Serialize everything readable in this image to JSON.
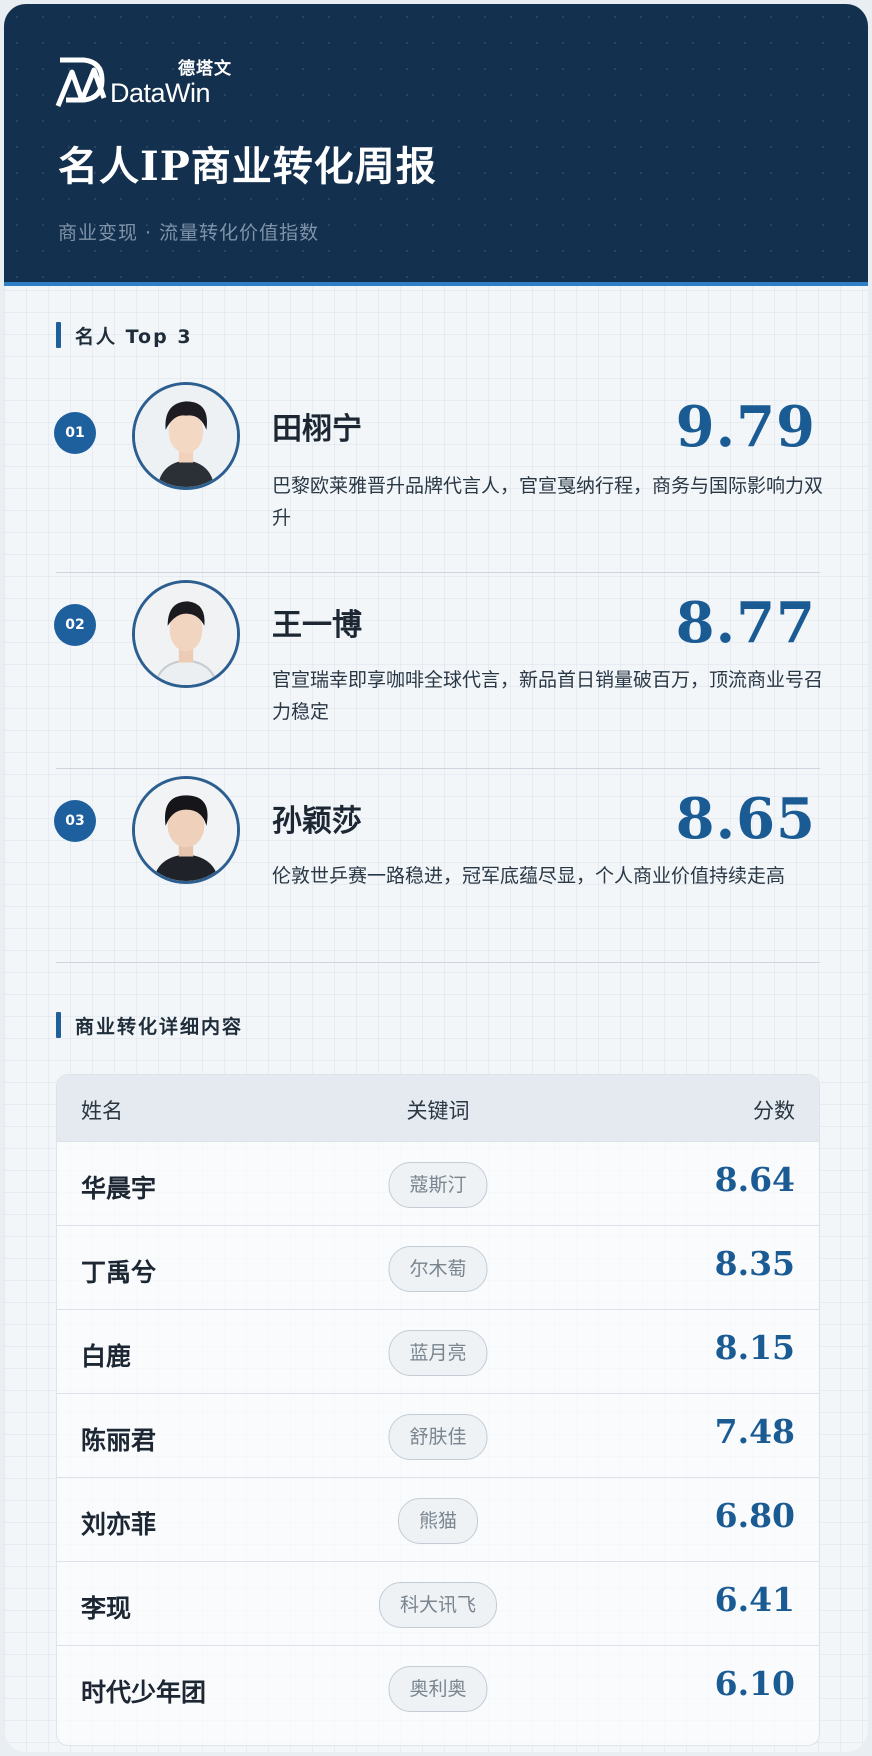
{
  "brand": {
    "logo_cn": "德塔文",
    "logo_en": "DataWin"
  },
  "header": {
    "title": "名人IP商业转化周报",
    "subtitle": "商业变现 · 流量转化价值指数"
  },
  "top3": {
    "section_title": "名人 Top 3",
    "items": [
      {
        "rank": "01",
        "name": "田栩宁",
        "score": "9.79",
        "desc": "巴黎欧莱雅晋升品牌代言人，官宣戛纳行程，商务与国际影响力双升"
      },
      {
        "rank": "02",
        "name": "王一博",
        "score": "8.77",
        "desc": "官宣瑞幸即享咖啡全球代言，新品首日销量破百万，顶流商业号召力稳定"
      },
      {
        "rank": "03",
        "name": "孙颖莎",
        "score": "8.65",
        "desc": "伦敦世乒赛一路稳进，冠军底蕴尽显，个人商业价值持续走高"
      }
    ]
  },
  "details": {
    "section_title": "商业转化详细内容",
    "columns": {
      "name": "姓名",
      "keyword": "关键词",
      "score": "分数"
    },
    "rows": [
      {
        "name": "华晨宇",
        "keyword": "蔻斯汀",
        "score": "8.64"
      },
      {
        "name": "丁禹兮",
        "keyword": "尔木萄",
        "score": "8.35"
      },
      {
        "name": "白鹿",
        "keyword": "蓝月亮",
        "score": "8.15"
      },
      {
        "name": "陈丽君",
        "keyword": "舒肤佳",
        "score": "7.48"
      },
      {
        "name": "刘亦菲",
        "keyword": "熊猫",
        "score": "6.80"
      },
      {
        "name": "李现",
        "keyword": "科大讯飞",
        "score": "6.41"
      },
      {
        "name": "时代少年团",
        "keyword": "奥利奥",
        "score": "6.10"
      }
    ]
  },
  "colors": {
    "header_bg": "#13304f",
    "accent": "#1b5b93",
    "badge": "#1e5f9e",
    "page_bg": "#f2f6f9"
  }
}
